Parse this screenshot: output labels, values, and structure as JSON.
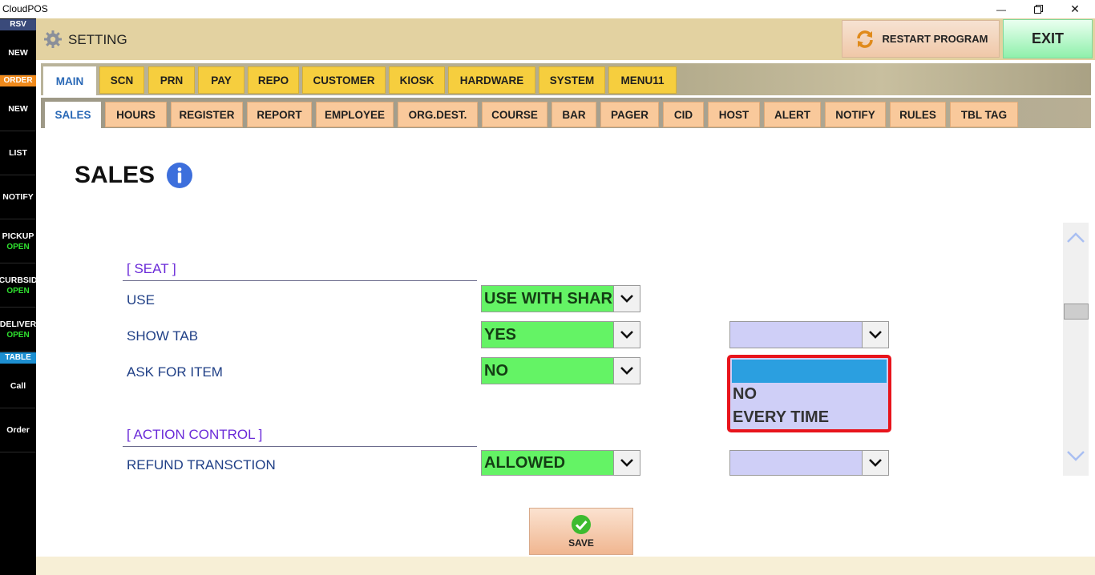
{
  "window": {
    "title": "CloudPOS",
    "minimize_glyph": "—",
    "restore_icon": "restore-icon",
    "close_glyph": "✕"
  },
  "sidebar": {
    "rsv_head": "RSV",
    "new1": "NEW",
    "order_head": "ORDER",
    "new2": "NEW",
    "list": "LIST",
    "notify": "NOTIFY",
    "pickup": "PICKUP",
    "pickup_status": "OPEN",
    "curbside": "CURBSID",
    "curbside_status": "OPEN",
    "delivery": "DELIVER",
    "delivery_status": "OPEN",
    "table_head": "TABLE",
    "call": "Call",
    "order": "Order",
    "colors": {
      "rsv": "#3a4a7a",
      "order": "#f08a1c",
      "table": "#1d8fd1",
      "open": "#2fe02f"
    }
  },
  "header": {
    "title": "SETTING",
    "restart_label": "RESTART PROGRAM",
    "exit_label": "EXIT"
  },
  "tabs_main": [
    "MAIN",
    "SCN",
    "PRN",
    "PAY",
    "REPO",
    "CUSTOMER",
    "KIOSK",
    "HARDWARE",
    "SYSTEM",
    "MENU11"
  ],
  "tabs_sub": [
    "SALES",
    "HOURS",
    "REGISTER",
    "REPORT",
    "EMPLOYEE",
    "ORG.DEST.",
    "COURSE",
    "BAR",
    "PAGER",
    "CID",
    "HOST",
    "ALERT",
    "NOTIFY",
    "RULES",
    "TBL TAG"
  ],
  "page": {
    "title": "SALES",
    "seat_section": "[ SEAT ]",
    "use_label": "USE",
    "use_value": "USE WITH SHAR",
    "show_tab_label": "SHOW TAB",
    "show_tab_value": "YES",
    "show_tab_extra_value": "",
    "ask_label": "ASK FOR ITEM",
    "ask_value": "NO",
    "action_section": "[ ACTION CONTROL ]",
    "refund_label": "REFUND TRANSCTION",
    "refund_value": "ALLOWED",
    "refund_extra_value": "",
    "save_label": "SAVE"
  },
  "dropdown": {
    "options": [
      "",
      "NO",
      "EVERY TIME"
    ],
    "highlight_color": "#2b9fe0",
    "border_color": "#e8141c"
  }
}
